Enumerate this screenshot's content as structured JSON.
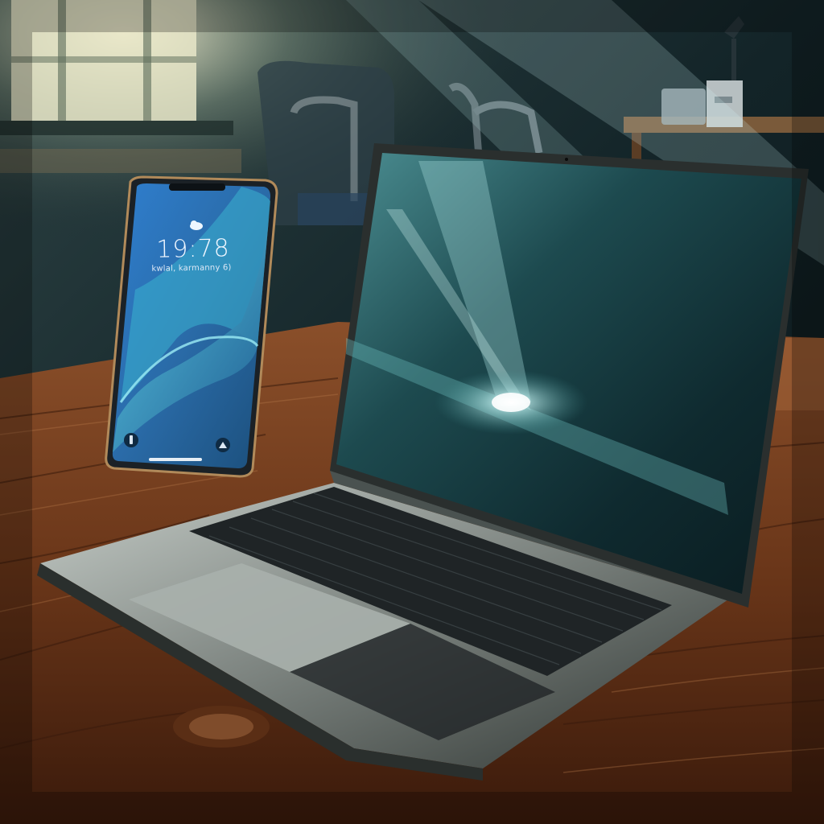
{
  "scene": {
    "description_icons": [
      "phone-lockscreen",
      "laptop",
      "desk",
      "window",
      "chair"
    ]
  },
  "phone": {
    "clock": "19:78",
    "date": "kwlal, karmanny 6)",
    "status": "",
    "lock_icon": "cloud-lock-icon",
    "bottom_left_icon": "flashlight-icon",
    "bottom_right_icon": "camera-icon"
  },
  "laptop": {
    "screen_state": "wallpaper",
    "hinge_label": ""
  },
  "colors": {
    "wood": "#7a4524",
    "wood_dark": "#4a2412",
    "laptop_body": "#8f9693",
    "screen_teal": "#2d6b6c",
    "phone_blue": "#2a86c7"
  }
}
